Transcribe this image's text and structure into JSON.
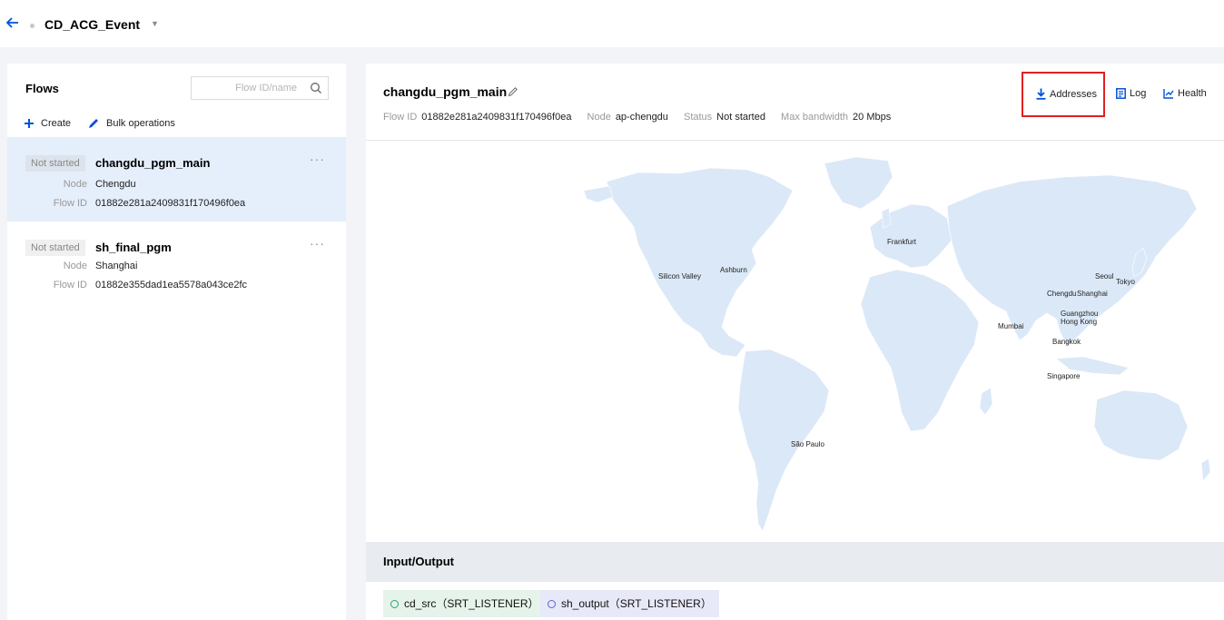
{
  "header": {
    "event_name": "CD_ACG_Event",
    "back_icon": "arrow-left-icon",
    "dropdown_icon": "caret-down-icon"
  },
  "flows_panel": {
    "title": "Flows",
    "search_placeholder": "Flow ID/name",
    "toolbar": {
      "create_label": "Create",
      "bulk_label": "Bulk operations"
    },
    "field_labels": {
      "node": "Node",
      "flow_id": "Flow ID"
    },
    "items": [
      {
        "status": "Not started",
        "name": "changdu_pgm_main",
        "node": "Chengdu",
        "flow_id": "01882e281a2409831f170496f0ea",
        "selected": true
      },
      {
        "status": "Not started",
        "name": "sh_final_pgm",
        "node": "Shanghai",
        "flow_id": "01882e355dad1ea5578a043ce2fc",
        "selected": false
      }
    ],
    "more_label": "···"
  },
  "detail": {
    "title": "changdu_pgm_main",
    "meta": {
      "flow_id_label": "Flow ID",
      "flow_id": "01882e281a2409831f170496f0ea",
      "node_label": "Node",
      "node": "ap-chengdu",
      "status_label": "Status",
      "status": "Not started",
      "bandwidth_label": "Max bandwidth",
      "bandwidth": "20 Mbps"
    },
    "actions": {
      "addresses": "Addresses",
      "log": "Log",
      "health": "Health"
    },
    "map_cities": {
      "frankfurt": "Frankfurt",
      "silicon_valley": "Silicon Valley",
      "ashburn": "Ashburn",
      "seoul": "Seoul",
      "tokyo": "Tokyo",
      "chengdu": "Chengdu",
      "shanghai": "Shanghai",
      "guangzhou": "Guangzhou",
      "hong_kong": "Hong Kong",
      "mumbai": "Mumbai",
      "bangkok": "Bangkok",
      "singapore": "Singapore",
      "sao_paulo": "São Paulo"
    },
    "io": {
      "title": "Input/Output",
      "input_tag": "cd_src（SRT_LISTENER）",
      "output_tag": "sh_output（SRT_LISTENER）"
    }
  },
  "colors": {
    "accent": "#0052d9",
    "highlight": "#e02020",
    "map_land": "#dbe8f7",
    "selected_row": "#e5eefb"
  }
}
